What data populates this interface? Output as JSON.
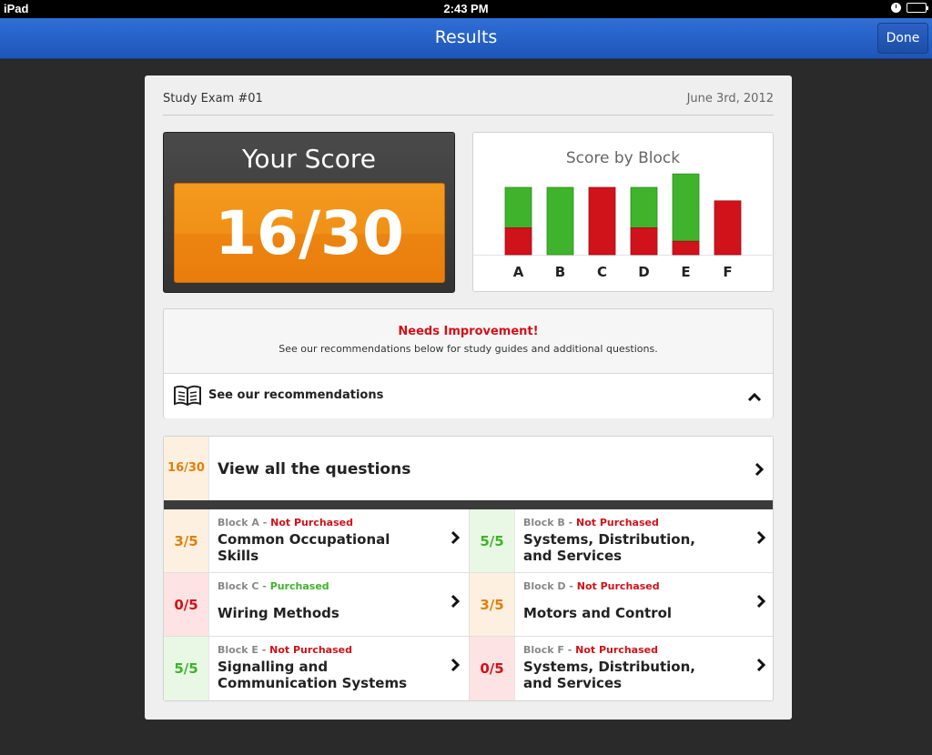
{
  "status_bar": {
    "device": "iPad",
    "time": "2:43 PM"
  },
  "nav": {
    "title": "Results",
    "done_label": "Done"
  },
  "header": {
    "exam_name": "Study Exam #01",
    "date": "June 3rd, 2012"
  },
  "score": {
    "title": "Your Score",
    "value": "16/30"
  },
  "chart_data": {
    "type": "bar",
    "title": "Score by Block",
    "categories": [
      "A",
      "B",
      "C",
      "D",
      "E",
      "F"
    ],
    "series": [
      {
        "values": [
          3,
          5,
          0,
          3,
          5,
          0
        ],
        "color": "#3fb32c"
      },
      {
        "values": [
          2,
          0,
          5,
          2,
          1,
          4
        ],
        "color": "#d0121b"
      }
    ],
    "stacked": true,
    "ylim": [
      0,
      5
    ]
  },
  "improvement": {
    "title": "Needs Improvement!",
    "subtitle": "See our recommendations below for study guides and additional questions.",
    "recommendations_label": "See our recommendations"
  },
  "questions": {
    "all_score": "16/30",
    "all_label": "View all the questions",
    "blocks": [
      {
        "score": "3/5",
        "block": "Block A",
        "sep": " - ",
        "status": "Not Purchased",
        "name": "Common Occupational Skills"
      },
      {
        "score": "5/5",
        "block": "Block B",
        "sep": " - ",
        "status": "Not Purchased",
        "name": "Systems, Distribution, and Services"
      },
      {
        "score": "0/5",
        "block": "Block C",
        "sep": " - ",
        "status": "Purchased",
        "name": "Wiring Methods"
      },
      {
        "score": "3/5",
        "block": "Block D",
        "sep": " - ",
        "status": "Not Purchased",
        "name": "Motors and Control"
      },
      {
        "score": "5/5",
        "block": "Block E",
        "sep": " - ",
        "status": "Not Purchased",
        "name": "Signalling and Communication Systems"
      },
      {
        "score": "0/5",
        "block": "Block F",
        "sep": " - ",
        "status": "Not Purchased",
        "name": "Systems, Distribution, and Services"
      }
    ]
  },
  "colors": {
    "accent_orange": "#f19117",
    "nav_blue": "#2f6fd6",
    "success": "#3fb32c",
    "danger": "#d0121b"
  }
}
